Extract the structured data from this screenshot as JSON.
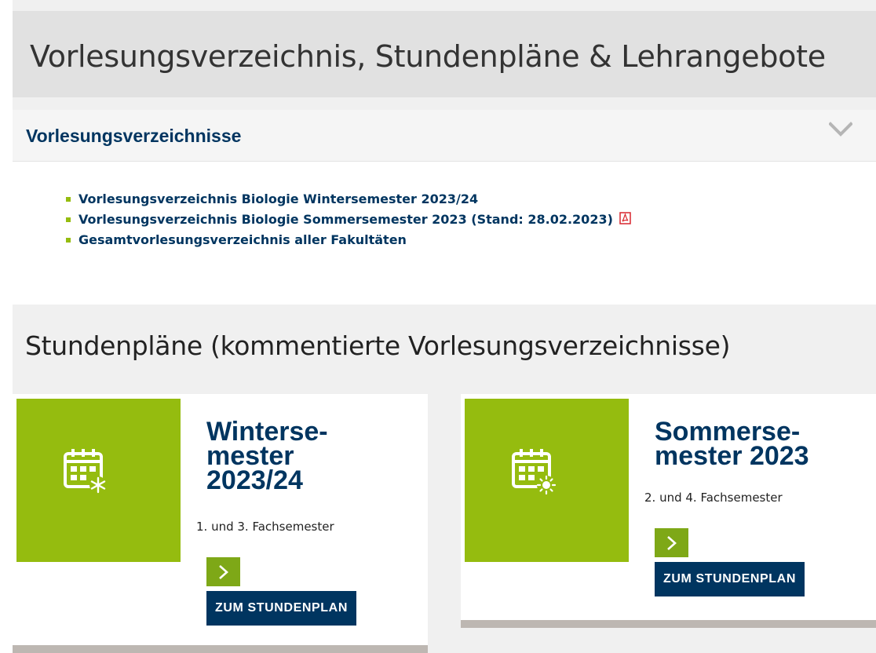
{
  "header": {
    "title": "Vorlesungsverzeichnis, Stundenpläne & Lehrangebote"
  },
  "accordion": {
    "title": "Vorlesungsverzeichnisse",
    "links": [
      {
        "label": "Vorlesungsverzeichnis Biologie Wintersemester 2023/24",
        "pdf": false
      },
      {
        "label": "Vorlesungsverzeichnis Biologie Sommersemester 2023 (Stand: 28.02.2023)",
        "pdf": true,
        "icon": "pdf-icon"
      },
      {
        "label": "Gesamtvorlesungsverzeichnis aller Fakultäten",
        "pdf": false
      }
    ]
  },
  "schedules": {
    "title": "Stundenpläne (kommentierte Vorlesungsverzeichnisse)",
    "cards": [
      {
        "title_lines": [
          "Winterse-",
          "mester",
          "2023/24"
        ],
        "subtitle": "1. und 3. Fachsemester",
        "icon": "calendar-snowflake-icon",
        "button_label": "ZUM STUNDENPLAN"
      },
      {
        "title_lines": [
          "Sommerse-",
          "mester 2023"
        ],
        "subtitle": "2. und 4. Fachsemester",
        "icon": "calendar-sun-icon",
        "button_label": "ZUM STUNDENPLAN"
      }
    ]
  },
  "colors": {
    "brand_blue": "#003560",
    "brand_green": "#95bc0f",
    "button_green": "#7ea817",
    "header_gray": "#e1e1e1"
  }
}
